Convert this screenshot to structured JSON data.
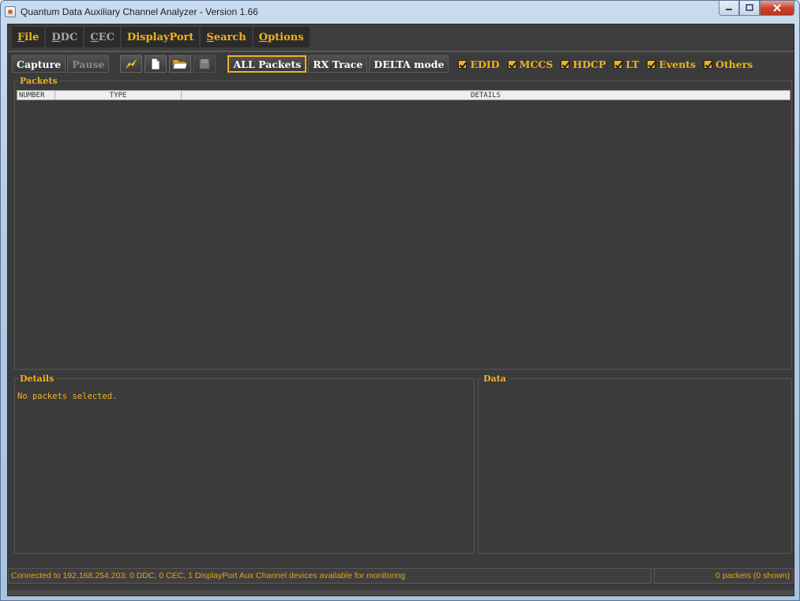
{
  "window": {
    "title": "Quantum Data Auxiliary Channel Analyzer - Version 1.66",
    "controls": {
      "minimize": "▭",
      "maximize": "☐",
      "close": "x"
    }
  },
  "menu": [
    {
      "label": "File",
      "mnemonic": "F",
      "rest": "ile",
      "enabled": true
    },
    {
      "label": "DDC",
      "mnemonic": "D",
      "rest": "DC",
      "enabled": false
    },
    {
      "label": "CEC",
      "mnemonic": "C",
      "rest": "EC",
      "enabled": false
    },
    {
      "label": "DisplayPort",
      "mnemonic": "",
      "rest": "DisplayPort",
      "enabled": true
    },
    {
      "label": "Search",
      "mnemonic": "S",
      "rest": "earch",
      "enabled": true
    },
    {
      "label": "Options",
      "mnemonic": "O",
      "rest": "ptions",
      "enabled": true
    }
  ],
  "toolbar": {
    "capture_label": "Capture",
    "pause_label": "Pause",
    "icons": [
      "lightning-icon",
      "new-file-icon",
      "open-folder-icon",
      "save-icon"
    ],
    "modes": [
      "ALL Packets",
      "RX Trace",
      "DELTA mode"
    ],
    "active_mode": "ALL Packets",
    "filters": [
      {
        "label": "EDID",
        "checked": true
      },
      {
        "label": "MCCS",
        "checked": true
      },
      {
        "label": "HDCP",
        "checked": true
      },
      {
        "label": "LT",
        "checked": true
      },
      {
        "label": "Events",
        "checked": true
      },
      {
        "label": "Others",
        "checked": true
      }
    ]
  },
  "packets_panel": {
    "title": "Packets",
    "columns": [
      "NUMBER",
      "TYPE",
      "DETAILS"
    ]
  },
  "details_panel": {
    "title": "Details",
    "text": "No packets selected."
  },
  "data_panel": {
    "title": "Data"
  },
  "status": {
    "connection": "Connected to 192.168.254.203: 0 DDC, 0 CEC, 1 DisplayPort Aux Channel devices available for monitoring",
    "count": "0 packets (0 shown)"
  },
  "colors": {
    "accent": "#f2b31a",
    "background": "#3b3b3b",
    "disabled": "#a6a6a6"
  }
}
